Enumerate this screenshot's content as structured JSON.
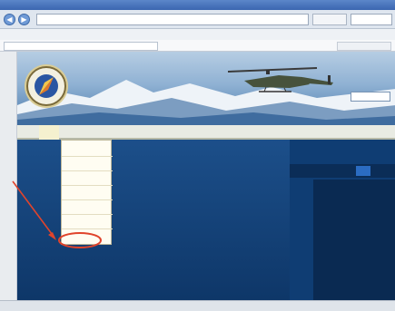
{
  "window": {
    "title": "",
    "url": "",
    "menus": [
      "",
      "",
      "",
      "",
      "",
      "",
      ""
    ],
    "tab_title": ""
  },
  "site": {
    "nav": [
      {
        "label": ""
      },
      {
        "label": ""
      },
      {
        "label": ""
      },
      {
        "label": ""
      },
      {
        "label": ""
      },
      {
        "label": ""
      },
      {
        "label": ""
      },
      {
        "label": ""
      },
      {
        "label": ""
      },
      {
        "label": ""
      },
      {
        "label": ""
      }
    ],
    "dropdown": [
      {
        "label": ""
      },
      {
        "label": ""
      },
      {
        "label": ""
      },
      {
        "label": ""
      },
      {
        "label": ""
      },
      {
        "label": ""
      },
      {
        "label": ""
      }
    ],
    "summit_title": "",
    "summit_text": "",
    "date": {
      "day": "",
      "num": "",
      "tail": ""
    },
    "news": {
      "title": "",
      "items": [
        "",
        "",
        "",
        ""
      ],
      "footer": ""
    }
  },
  "colors": {
    "page_bg": "#0f3d73",
    "nav_bg": "#e9ebe3",
    "callout": "#e0442c"
  }
}
